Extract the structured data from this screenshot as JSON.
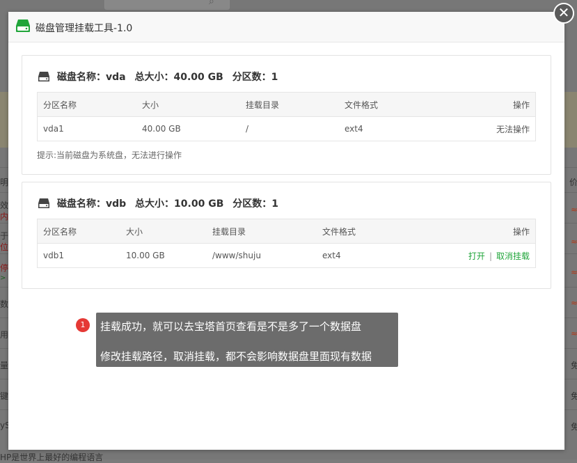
{
  "background": {
    "left_fragments": [
      "明",
      "效",
      "内容",
      "于",
      "位",
      "停",
      "> >",
      "数",
      "用",
      "量",
      "键",
      "yS"
    ],
    "right_fragments": [
      "价",
      "≈",
      "≈",
      "≈",
      "≈",
      "≈",
      "免",
      "免",
      "免"
    ],
    "bottom_text": "HP是世界上最好的编程语言"
  },
  "dialog": {
    "title": "磁盘管理挂载工具-1.0",
    "close_symbol": "✕"
  },
  "disks": [
    {
      "label_name": "磁盘名称：vda",
      "label_size": "总大小：40.00 GB",
      "label_parts": "分区数：1",
      "columns": [
        "分区名称",
        "大小",
        "挂载目录",
        "文件格式",
        "操作"
      ],
      "rows": [
        {
          "name": "vda1",
          "size": "40.00 GB",
          "mount": "/",
          "fs": "ext4",
          "action": "无法操作"
        }
      ],
      "tip": "提示:当前磁盘为系统盘，无法进行操作"
    },
    {
      "label_name": "磁盘名称：vdb",
      "label_size": "总大小：10.00 GB",
      "label_parts": "分区数：1",
      "columns": [
        "分区名称",
        "大小",
        "挂载目录",
        "文件格式",
        "操作"
      ],
      "rows": [
        {
          "name": "vdb1",
          "size": "10.00 GB",
          "mount": "/www/shuju",
          "fs": "ext4",
          "action_open": "打开",
          "action_sep": "|",
          "action_unmount": "取消挂载"
        }
      ]
    }
  ],
  "annotation": {
    "number": "1",
    "line1": "挂载成功，就可以去宝塔首页查看是不是多了一个数据盘",
    "line2": "修改挂载路径，取消挂载，都不会影响数据盘里面现有数据"
  },
  "colors": {
    "accent_green": "#20a53a",
    "annotation_bg": "#6c6c6c",
    "annotation_dot": "#e53935"
  }
}
